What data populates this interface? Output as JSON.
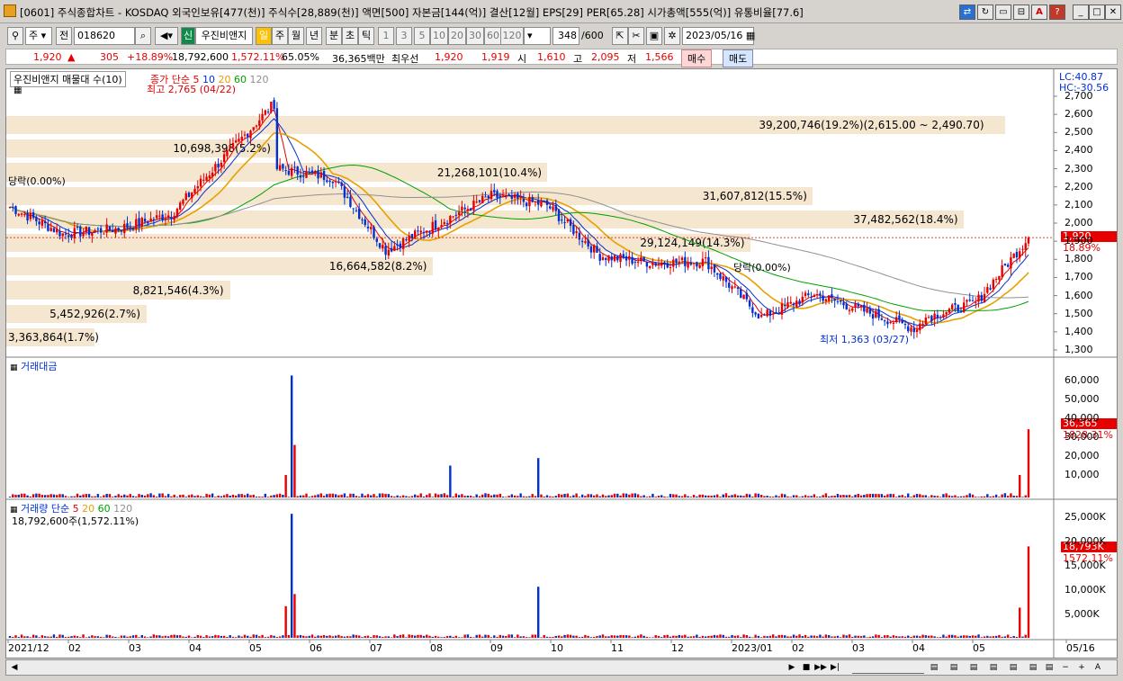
{
  "window": {
    "title": "[0601] 주식종합차트 - KOSDAQ 외국인보유[477(천)] 주식수[28,889(천)] 액면[500] 자본금[144(억)] 결산[12월] EPS[29] PER[65.28] 시가총액[555(억)] 유통비율[77.6]"
  },
  "toolbar": {
    "market": "주",
    "prev": "전",
    "code": "018620",
    "badge": "신",
    "stock_name": "우진비앤지",
    "periods": [
      "일",
      "주",
      "월",
      "년",
      "분",
      "초",
      "틱"
    ],
    "nums": [
      "1",
      "3",
      "5",
      "10",
      "20",
      "30",
      "60",
      "120"
    ],
    "count": "348",
    "count_total": "/600",
    "date": "2023/05/16"
  },
  "info": {
    "price": "1,920",
    "arrow": "▲",
    "change": "305",
    "change_pct": "+18.89%",
    "volume": "18,792,600",
    "volume_pct": "1,572.11%",
    "ratio": "65.05%",
    "amount": "36,365백만",
    "best_label": "최우선",
    "best_sell": "1,920",
    "best_buy": "1,919",
    "open_label": "시",
    "open": "1,610",
    "high_label": "고",
    "high": "2,095",
    "low_label": "저",
    "low": "1,566",
    "buy_btn": "매수",
    "sell_btn": "매도"
  },
  "price_panel": {
    "title": "우진비앤지 매물대 수(10)",
    "ma_label": "종가 단순",
    "ma_periods": [
      "5",
      "10",
      "20",
      "60",
      "120"
    ],
    "lc": "LC:40.87",
    "hc": "HC:-30.56",
    "high_note": "최고 2,765 (04/22)",
    "low_note": "최저 1,363 (03/27)",
    "drop_note_left": "당락(0.00%)",
    "drop_note_right": "당락(0.00%)",
    "current_price": "1,920",
    "current_pct": "18.89%",
    "y_ticks": [
      "2,700",
      "2,600",
      "2,500",
      "2,400",
      "2,300",
      "2,200",
      "2,100",
      "2,000",
      "1,900",
      "1,800",
      "1,700",
      "1,600",
      "1,500",
      "1,400",
      "1,300"
    ],
    "volume_profile": [
      {
        "label": "39,200,746(19.2%)(2,615.00 ~ 2,490.70)",
        "pct": 19.2
      },
      {
        "label": "10,698,398(5.2%)",
        "pct": 5.2
      },
      {
        "label": "21,268,101(10.4%)",
        "pct": 10.4
      },
      {
        "label": "31,607,812(15.5%)",
        "pct": 15.5
      },
      {
        "label": "37,482,562(18.4%)",
        "pct": 18.4
      },
      {
        "label": "29,124,149(14.3%)",
        "pct": 14.3
      },
      {
        "label": "16,664,582(8.2%)",
        "pct": 8.2
      },
      {
        "label": "8,821,546(4.3%)",
        "pct": 4.3
      },
      {
        "label": "5,452,926(2.7%)",
        "pct": 2.7
      },
      {
        "label": "3,363,864(1.7%)",
        "pct": 1.7
      }
    ]
  },
  "amount_panel": {
    "title": "거래대금",
    "y_ticks": [
      "60,000",
      "50,000",
      "40,000",
      "30,000",
      "20,000",
      "10,000"
    ],
    "current": "36,365",
    "current_pct": "1828.31%"
  },
  "volume_panel": {
    "title": "거래량 단순",
    "ma_periods": [
      "5",
      "20",
      "60",
      "120"
    ],
    "subtitle": "18,792,600주(1,572.11%)",
    "y_ticks": [
      "25,000K",
      "20,000K",
      "15,000K",
      "10,000K",
      "5,000K"
    ],
    "current": "18,793K",
    "current_pct": "1572.11%"
  },
  "x_axis": [
    "2021/12",
    "02",
    "03",
    "04",
    "05",
    "06",
    "07",
    "08",
    "09",
    "10",
    "11",
    "12",
    "2023/01",
    "02",
    "03",
    "04",
    "05",
    "05/16"
  ],
  "colors": {
    "up": "#e60000",
    "down": "#0030d0",
    "ma5": "#e60000",
    "ma10": "#0030d0",
    "ma20": "#e8a000",
    "ma60": "#00a000",
    "ma120": "#909090",
    "band": "#f5e6d0"
  },
  "chart_data": {
    "type": "candlestick",
    "title": "우진비앤지",
    "price_range": [
      1300,
      2700
    ],
    "approx_close_path": [
      {
        "t": "2021/12",
        "v": 2090
      },
      {
        "t": "02",
        "v": 1940
      },
      {
        "t": "03",
        "v": 1970
      },
      {
        "t": "04",
        "v": 2050
      },
      {
        "t": "04/22",
        "v": 2765
      },
      {
        "t": "05",
        "v": 2300
      },
      {
        "t": "06",
        "v": 2250
      },
      {
        "t": "06-late",
        "v": 1850
      },
      {
        "t": "07",
        "v": 2000
      },
      {
        "t": "08",
        "v": 2150
      },
      {
        "t": "09",
        "v": 2100
      },
      {
        "t": "10",
        "v": 1820
      },
      {
        "t": "11",
        "v": 1780
      },
      {
        "t": "12",
        "v": 1790
      },
      {
        "t": "2023/01",
        "v": 1480
      },
      {
        "t": "02",
        "v": 1610
      },
      {
        "t": "03/27",
        "v": 1363
      },
      {
        "t": "04",
        "v": 1470
      },
      {
        "t": "05",
        "v": 1560
      },
      {
        "t": "05/16",
        "v": 1920
      }
    ]
  }
}
